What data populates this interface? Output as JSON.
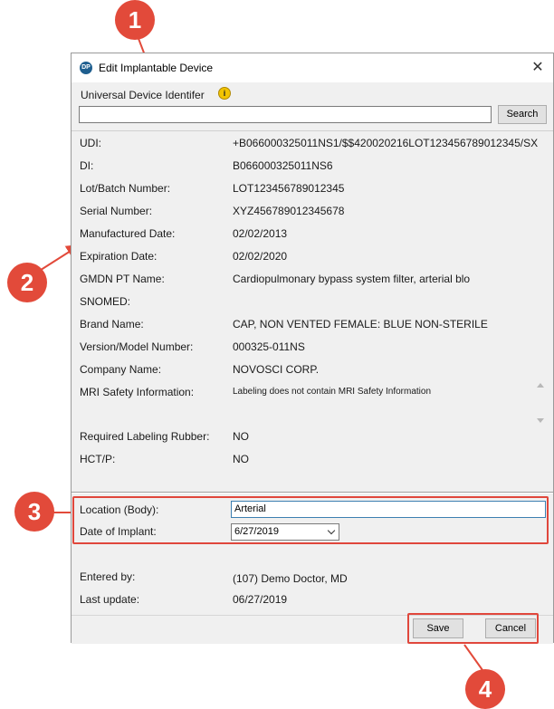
{
  "window": {
    "title": "Edit Implantable Device",
    "app_icon_glyph": "DP",
    "close_glyph": "✕"
  },
  "udi": {
    "label": "Universal Device Identifer",
    "input_value": "",
    "search_label": "Search",
    "info_icon_glyph": "i"
  },
  "fields": [
    {
      "label": "UDI:",
      "value": "+B066000325011NS1/$$420020216LOT123456789012345/SX"
    },
    {
      "label": "DI:",
      "value": "B066000325011NS6"
    },
    {
      "label": "Lot/Batch Number:",
      "value": "LOT123456789012345"
    },
    {
      "label": "Serial Number:",
      "value": "XYZ456789012345678"
    },
    {
      "label": "Manufactured Date:",
      "value": "02/02/2013"
    },
    {
      "label": "Expiration Date:",
      "value": "02/02/2020"
    },
    {
      "label": "GMDN PT Name:",
      "value": "Cardiopulmonary bypass system filter, arterial blo"
    },
    {
      "label": "SNOMED:",
      "value": ""
    },
    {
      "label": "Brand Name:",
      "value": "CAP, NON VENTED FEMALE: BLUE NON-STERILE"
    },
    {
      "label": "Version/Model Number:",
      "value": "000325-011NS"
    },
    {
      "label": "Company Name:",
      "value": "NOVOSCI CORP."
    },
    {
      "label": "MRI Safety Information:",
      "value": "Labeling does not contain MRI Safety Information"
    },
    {
      "label": "Required Labeling Rubber:",
      "value": "NO"
    },
    {
      "label": "HCT/P:",
      "value": "NO"
    }
  ],
  "implant": {
    "location_label": "Location (Body):",
    "location_value": "Arterial",
    "date_label": "Date of Implant:",
    "date_value": "6/27/2019"
  },
  "meta": {
    "entered_by_label": "Entered by:",
    "entered_by_value": "(107) Demo Doctor, MD",
    "last_update_label": "Last update:",
    "last_update_value": "06/27/2019"
  },
  "buttons": {
    "save": "Save",
    "cancel": "Cancel"
  },
  "callouts": [
    "1",
    "2",
    "3",
    "4"
  ],
  "colors": {
    "highlight": "#e0473c",
    "callout": "#e24a3a",
    "dialog_bg": "#f0f0f0"
  }
}
